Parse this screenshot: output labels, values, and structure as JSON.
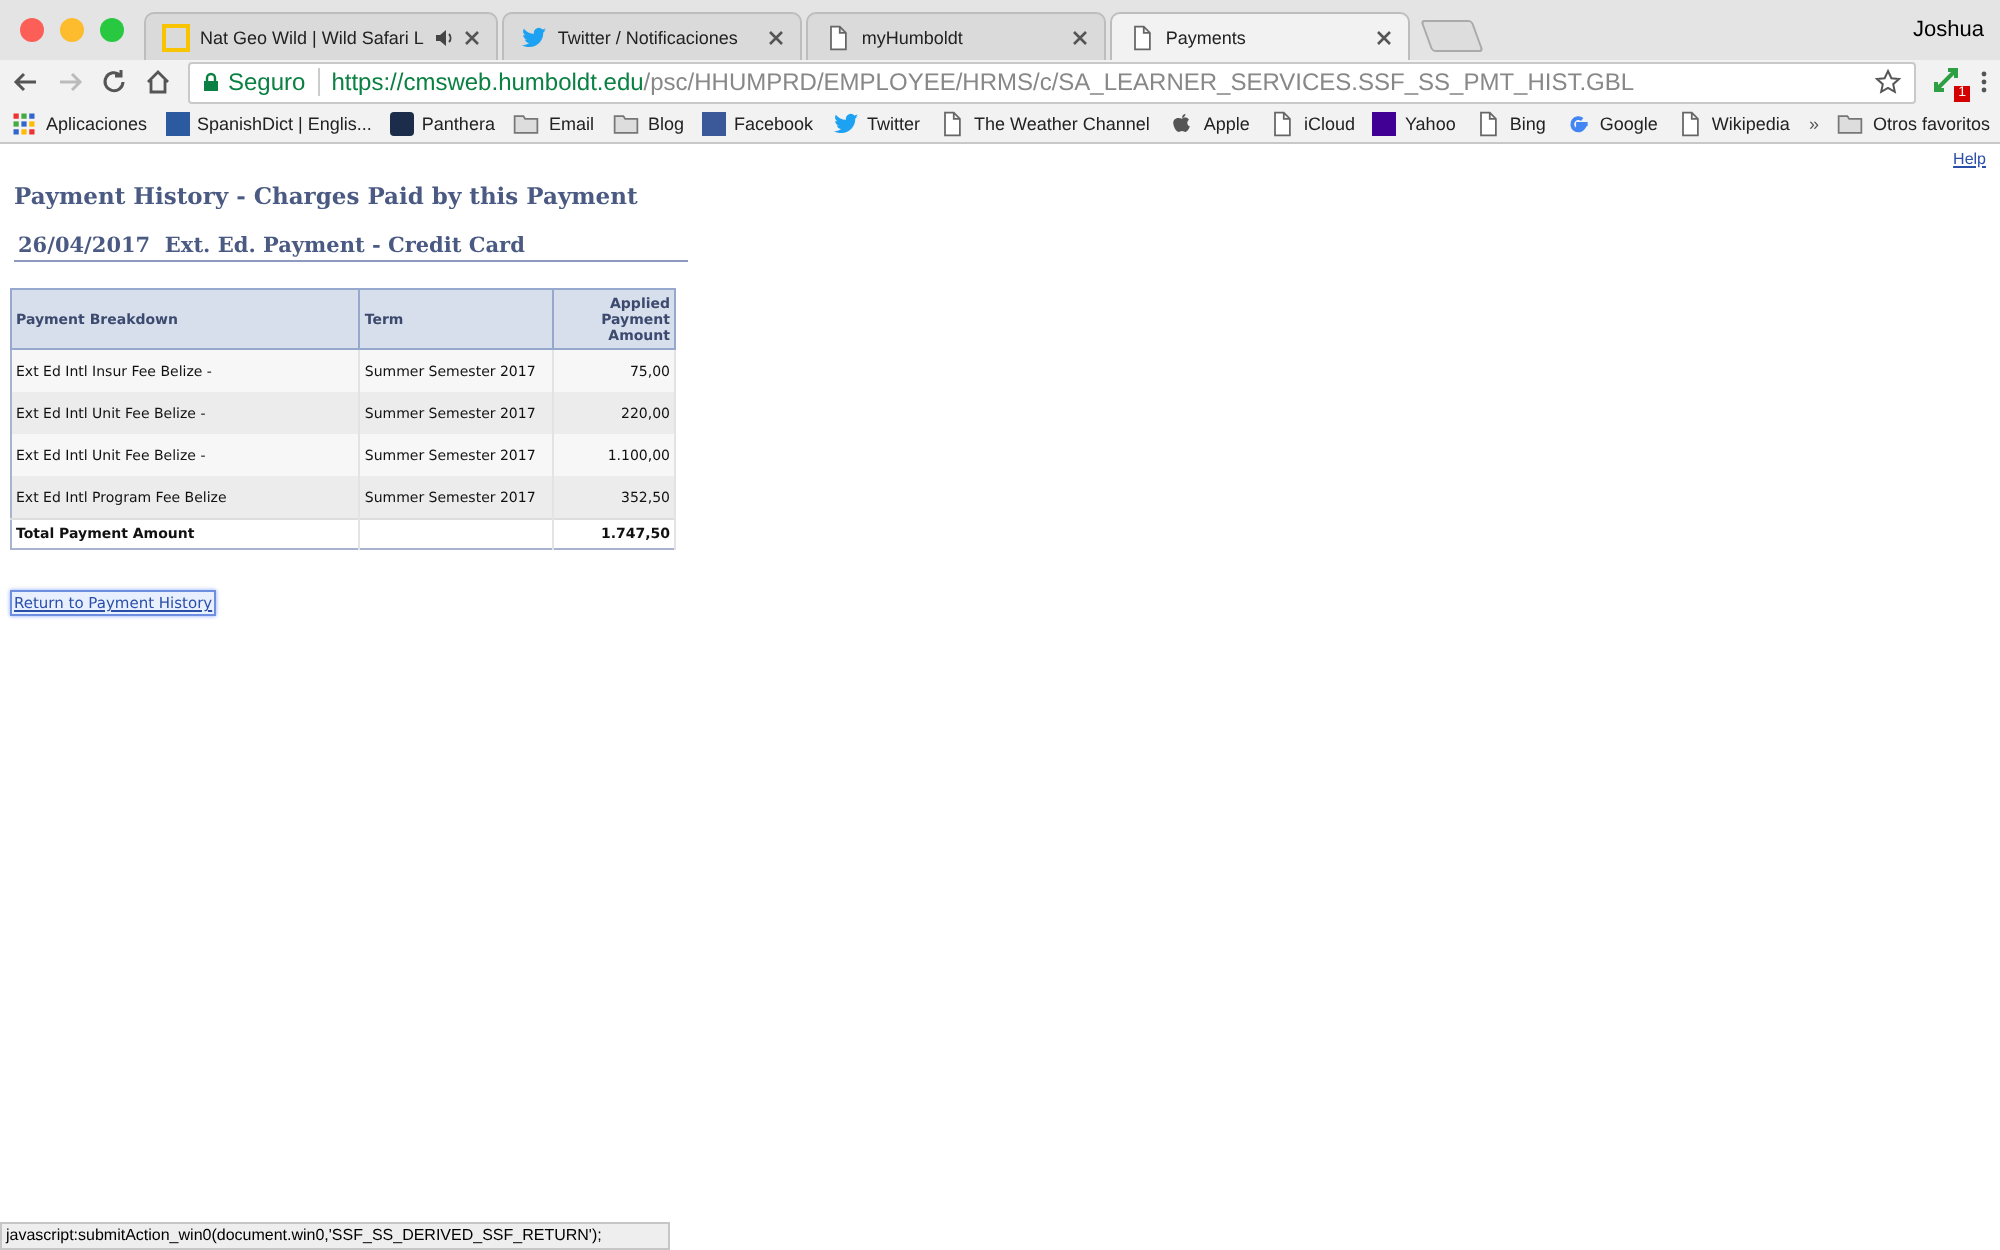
{
  "browser": {
    "tabs": [
      {
        "title": "Nat Geo Wild | Wild Safari L",
        "kind": "natgeo",
        "audio": true,
        "selected": false
      },
      {
        "title": "Twitter / Notificaciones",
        "kind": "twitter",
        "audio": false,
        "selected": false
      },
      {
        "title": "myHumboldt",
        "kind": "page",
        "audio": false,
        "selected": false
      },
      {
        "title": "Payments",
        "kind": "page",
        "audio": false,
        "selected": true
      }
    ],
    "profile": "Joshua",
    "address": {
      "security": "Seguro",
      "url_host": "https://cmsweb.humboldt.edu",
      "url_path": "/psc/HHUMPRD/EMPLOYEE/HRMS/c/SA_LEARNER_SERVICES.SSF_SS_PMT_HIST.GBL"
    },
    "extension_badge": "1",
    "bookmarks": [
      {
        "label": "Aplicaciones",
        "kind": "apps"
      },
      {
        "label": "SpanishDict | Englis...",
        "kind": "spanishdict"
      },
      {
        "label": "Panthera",
        "kind": "panthera"
      },
      {
        "label": "Email",
        "kind": "folder"
      },
      {
        "label": "Blog",
        "kind": "folder"
      },
      {
        "label": "Facebook",
        "kind": "facebook"
      },
      {
        "label": "Twitter",
        "kind": "twitter"
      },
      {
        "label": "The Weather Channel",
        "kind": "page"
      },
      {
        "label": "Apple",
        "kind": "apple"
      },
      {
        "label": "iCloud",
        "kind": "page"
      },
      {
        "label": "Yahoo",
        "kind": "yahoo"
      },
      {
        "label": "Bing",
        "kind": "page"
      },
      {
        "label": "Google",
        "kind": "google"
      },
      {
        "label": "Wikipedia",
        "kind": "page"
      }
    ],
    "overflow": "»",
    "other_bookmarks": "Otros favoritos"
  },
  "page": {
    "help_link": "Help",
    "title": "Payment History - Charges Paid by this Payment",
    "subtitle": "26/04/2017  Ext. Ed. Payment - Credit Card",
    "table": {
      "columns": [
        "Payment Breakdown",
        "Term",
        "Applied Payment Amount"
      ],
      "rows": [
        [
          "Ext Ed Intl Insur Fee Belize -",
          "Summer Semester 2017",
          "75,00"
        ],
        [
          "Ext Ed Intl Unit Fee Belize -",
          "Summer Semester 2017",
          "220,00"
        ],
        [
          "Ext Ed Intl Unit Fee Belize -",
          "Summer Semester 2017",
          "1.100,00"
        ],
        [
          "Ext Ed Intl Program Fee Belize",
          "Summer Semester 2017",
          "352,50"
        ]
      ],
      "total": {
        "label": "Total Payment Amount",
        "amount": "1.747,50"
      }
    },
    "return_link": "Return to Payment History"
  },
  "status_bar": "javascript:submitAction_win0(document.win0,'SSF_SS_DERIVED_SSF_RETURN');"
}
